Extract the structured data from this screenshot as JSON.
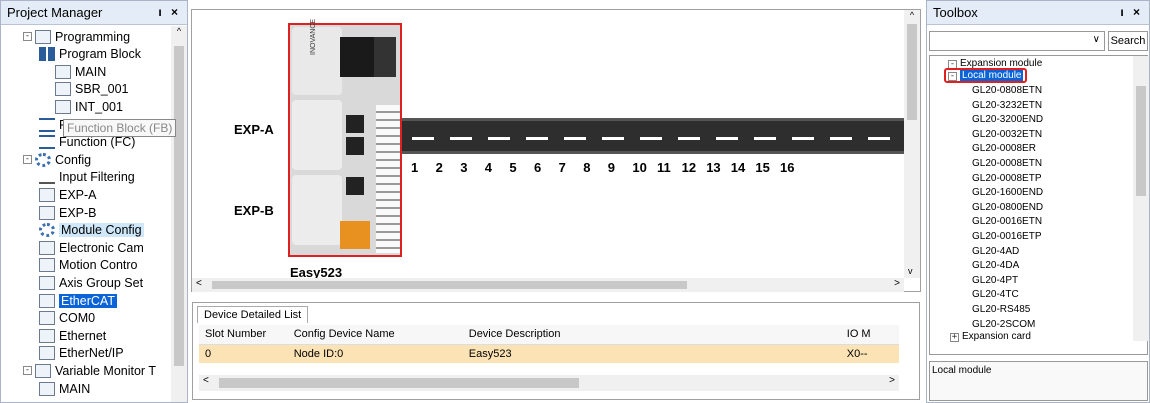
{
  "project_manager": {
    "title": "Project Manager",
    "pin_close": "ı ×",
    "tree": [
      {
        "label": "Programming",
        "indent": 1,
        "icon": "ladder-icon"
      },
      {
        "label": "Program Block",
        "indent": 2,
        "icon": "program-block-icon"
      },
      {
        "label": "MAIN",
        "indent": 3,
        "icon": "page-icon"
      },
      {
        "label": "SBR_001",
        "indent": 3,
        "icon": "page-icon"
      },
      {
        "label": "INT_001",
        "indent": 3,
        "icon": "page-icon"
      },
      {
        "label": "Function Block (FB)",
        "indent": 2,
        "icon": "function-block-icon"
      },
      {
        "label": "Function (FC)",
        "indent": 2,
        "icon": "function-icon"
      },
      {
        "label": "Config",
        "indent": 1,
        "icon": "config-icon"
      },
      {
        "label": "Input Filtering",
        "indent": 2,
        "icon": "filter-icon"
      },
      {
        "label": "EXP-A",
        "indent": 2,
        "icon": "expansion-icon"
      },
      {
        "label": "EXP-B",
        "indent": 2,
        "icon": "expansion-icon"
      },
      {
        "label": "Module Config",
        "indent": 2,
        "icon": "module-config-icon"
      },
      {
        "label": "Electronic Cam",
        "indent": 2,
        "icon": "cam-icon"
      },
      {
        "label": "Motion Contro",
        "indent": 2,
        "icon": "motion-icon"
      },
      {
        "label": "Axis Group Set",
        "indent": 2,
        "icon": "axis-group-icon"
      },
      {
        "label": "EtherCAT",
        "indent": 2,
        "icon": "ethercat-icon"
      },
      {
        "label": "COM0",
        "indent": 2,
        "icon": "com-icon"
      },
      {
        "label": "Ethernet",
        "indent": 2,
        "icon": "ethernet-icon"
      },
      {
        "label": "EtherNet/IP",
        "indent": 2,
        "icon": "ethernet-ip-icon"
      },
      {
        "label": "Variable Monitor T",
        "indent": 1,
        "icon": "monitor-icon"
      },
      {
        "label": "MAIN",
        "indent": 2,
        "icon": "page-icon"
      }
    ],
    "tooltip": "Function Block (FB)"
  },
  "canvas": {
    "device_label": "Easy523",
    "brand": "INOVANCE",
    "exp_a": "EXP-A",
    "exp_b": "EXP-B",
    "slots": [
      "1",
      "2",
      "3",
      "4",
      "5",
      "6",
      "7",
      "8",
      "9",
      "10",
      "11",
      "12",
      "13",
      "14",
      "15",
      "16"
    ]
  },
  "grid": {
    "tab": "Device Detailed List",
    "headers": [
      "Slot Number",
      "Config Device Name",
      "Device Description",
      "IO M"
    ],
    "rows": [
      [
        "0",
        "Node ID:0",
        "Easy523",
        "X0--"
      ]
    ]
  },
  "toolbox": {
    "title": "Toolbox",
    "pin_close": "ı ×",
    "search_label": "Search",
    "root": "Expansion module",
    "selected": "Local module",
    "items": [
      "GL20-0808ETN",
      "GL20-3232ETN",
      "GL20-3200END",
      "GL20-0032ETN",
      "GL20-0008ER",
      "GL20-0008ETN",
      "GL20-0008ETP",
      "GL20-1600END",
      "GL20-0800END",
      "GL20-0016ETN",
      "GL20-0016ETP",
      "GL20-4AD",
      "GL20-4DA",
      "GL20-4PT",
      "GL20-4TC",
      "GL20-RS485",
      "GL20-2SCOM"
    ],
    "card": "Expansion card",
    "description": "Local module"
  }
}
